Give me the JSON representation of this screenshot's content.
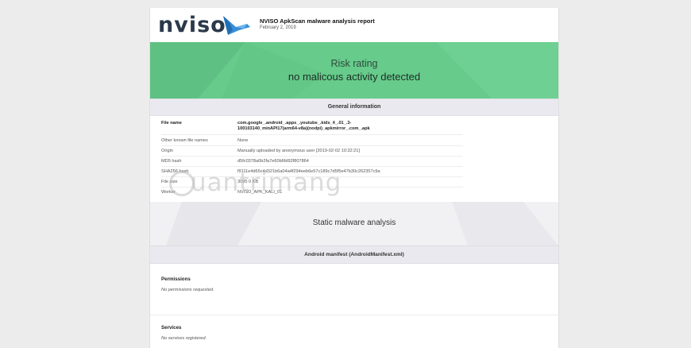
{
  "header": {
    "logo_text": "nviso",
    "report_title": "NVISO ApkScan malware analysis report",
    "report_date": "February 2, 2019"
  },
  "risk": {
    "title": "Risk rating",
    "verdict": "no malicous activity detected",
    "color": "#66cb8b"
  },
  "general": {
    "title": "General information",
    "rows": [
      {
        "key": "File name",
        "value": "com.google_.android_.apps_.youtube_.kids_4_.01_.3-"
      },
      {
        "key": "",
        "value": "100103140_minAPI17(arm64-v8a)(nodpi)_apkmirror_.com_.apk"
      },
      {
        "key": "Other known file names",
        "value": "None"
      },
      {
        "key": "Origin",
        "value": "Manually uploaded by anonymous user [2019-02-02 10:32:21]"
      },
      {
        "key": "MD5 hash",
        "value": "d5fc0378a0b2fa7e60b6fd92f807864"
      },
      {
        "key": "SHA256 hash",
        "value": "f9111e4d65c4d321b6a04a4f294eeb6e57c189c7d5f5e47b30c262357c9a"
      },
      {
        "key": "File size",
        "value": "3095 0 KB"
      },
      {
        "key": "Worker",
        "value": "NVISO_APK_KALI_01"
      }
    ]
  },
  "watermark": {
    "text": "uantrimang"
  },
  "static_analysis": {
    "title": "Static malware analysis"
  },
  "manifest": {
    "title": "Android manifest (AndroidManifest.xml)",
    "permissions_title": "Permissions",
    "permissions_text": "No permissions requested.",
    "services_title": "Services",
    "services_text": "No services registered."
  }
}
